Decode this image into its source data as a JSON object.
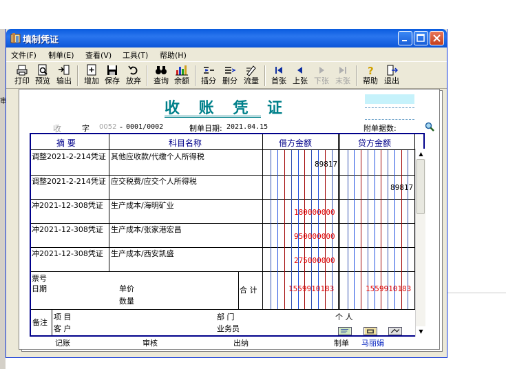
{
  "window": {
    "title": "填制凭证"
  },
  "menu": [
    {
      "label": "文件(F)"
    },
    {
      "label": "制单(E)"
    },
    {
      "label": "查看(V)"
    },
    {
      "label": "工具(T)"
    },
    {
      "label": "帮助(H)"
    }
  ],
  "toolbar": [
    {
      "label": "打印",
      "icon": "printer-icon",
      "enabled": true
    },
    {
      "label": "预览",
      "icon": "preview-icon",
      "enabled": true
    },
    {
      "label": "输出",
      "icon": "export-icon",
      "enabled": true
    },
    {
      "label": "增加",
      "icon": "add-icon",
      "enabled": true
    },
    {
      "label": "保存",
      "icon": "save-icon",
      "enabled": true
    },
    {
      "label": "放弃",
      "icon": "undo-icon",
      "enabled": true
    },
    {
      "label": "查询",
      "icon": "binoculars-icon",
      "enabled": true
    },
    {
      "label": "余额",
      "icon": "bar-chart-icon",
      "enabled": true
    },
    {
      "label": "插分",
      "icon": "insert-row-icon",
      "enabled": true
    },
    {
      "label": "删分",
      "icon": "delete-row-icon",
      "enabled": true
    },
    {
      "label": "流量",
      "icon": "flow-icon",
      "enabled": true
    },
    {
      "label": "首张",
      "icon": "first-icon",
      "enabled": true
    },
    {
      "label": "上张",
      "icon": "prev-icon",
      "enabled": true
    },
    {
      "label": "下张",
      "icon": "next-icon",
      "enabled": false
    },
    {
      "label": "末张",
      "icon": "last-icon",
      "enabled": false
    },
    {
      "label": "帮助",
      "icon": "help-icon",
      "enabled": true
    },
    {
      "label": "退出",
      "icon": "exit-icon",
      "enabled": true
    }
  ],
  "voucher": {
    "title": "收 账 凭 证",
    "type_char": "收",
    "zi": "字",
    "number_prefix": "0052",
    "number_dash": "-",
    "number": "0001/0002",
    "date_label": "制单日期:",
    "date": "2021.04.15",
    "attachments_label": "附单据数:",
    "col_summary": "摘 要",
    "col_account": "科目名称",
    "col_debit": "借方金额",
    "col_credit": "贷方金额",
    "rows": [
      {
        "summary": "调整2021-2-214凭证",
        "account": "其他应收款/代缴个人所得税",
        "debit": "89817",
        "credit": ""
      },
      {
        "summary": "调整2021-2-214凭证",
        "account": "应交税费/应交个人所得税",
        "debit": "",
        "credit": "89817"
      },
      {
        "summary": "冲2021-12-308凭证",
        "account": "生产成本/海明矿业",
        "debit": "180000000",
        "credit": ""
      },
      {
        "summary": "冲2021-12-308凭证",
        "account": "生产成本/张家港宏昌",
        "debit": "950000000",
        "credit": ""
      },
      {
        "summary": "冲2021-12-308凭证",
        "account": "生产成本/西安凯盛",
        "debit": "275000000",
        "credit": ""
      }
    ],
    "ticket_label": "票号",
    "date_row_label": "日期",
    "price_label": "单价",
    "qty_label": "数量",
    "total_label": "合 计",
    "total_debit": "1559910183",
    "total_credit": "1559910183",
    "remark_label": "备注",
    "project_label": "项 目",
    "customer_label": "客 户",
    "dept_label": "部 门",
    "salesman_label": "业务员",
    "person_label": "个 人"
  },
  "footer": {
    "bookkeeping": "记账",
    "audit": "审核",
    "cashier": "出纳",
    "maker_label": "制单",
    "maker": "马丽娟"
  },
  "background": {
    "edge_text": "审"
  },
  "colors": {
    "title_teal": "#00808a",
    "amount_red": "#e00000",
    "grid_blue": "#00008a"
  }
}
